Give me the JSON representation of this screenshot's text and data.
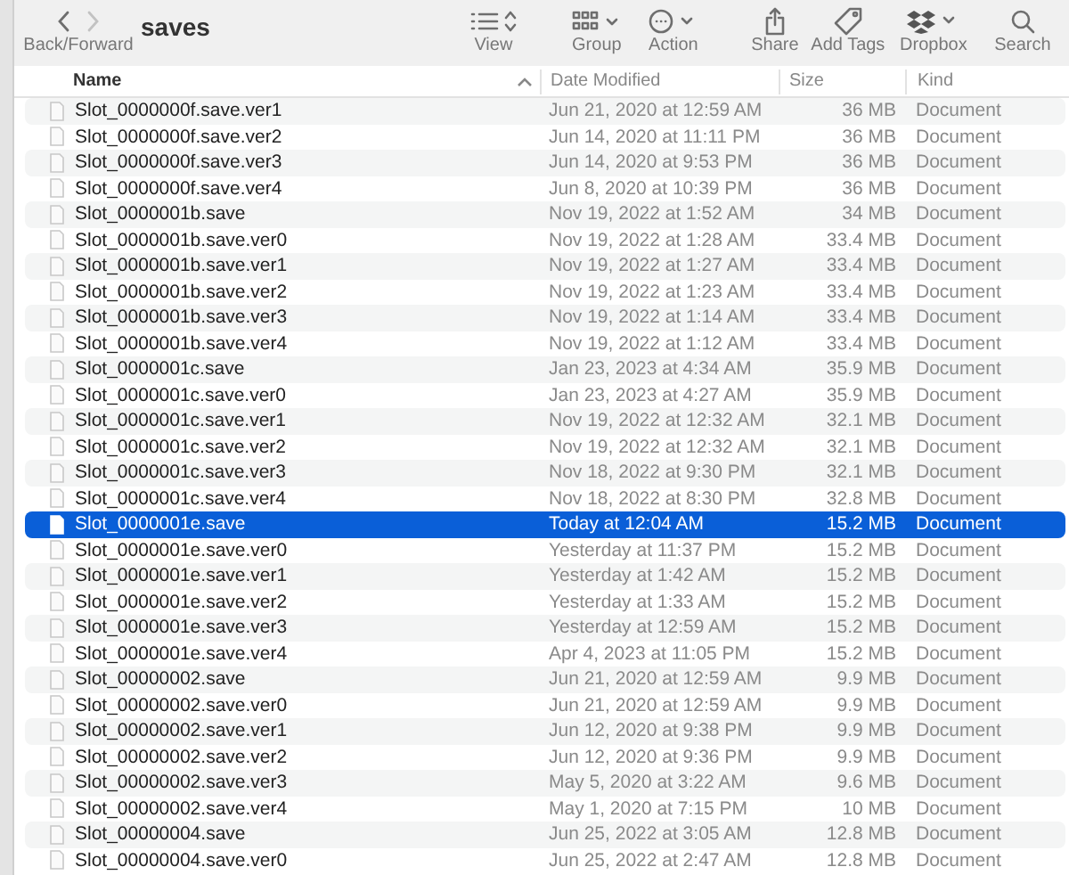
{
  "window": {
    "title": "saves"
  },
  "toolbar": {
    "back_forward_label": "Back/Forward",
    "back_enabled": true,
    "forward_enabled": false,
    "items": [
      {
        "kind": "view",
        "label": "View"
      },
      {
        "kind": "group",
        "label": "Group"
      },
      {
        "kind": "action",
        "label": "Action"
      },
      {
        "kind": "share",
        "label": "Share"
      },
      {
        "kind": "tags",
        "label": "Add Tags"
      },
      {
        "kind": "dropbox",
        "label": "Dropbox"
      },
      {
        "kind": "search",
        "label": "Search"
      }
    ]
  },
  "table": {
    "columns": [
      {
        "label": "Name",
        "sorted": true
      },
      {
        "label": "Date Modified",
        "sorted": false
      },
      {
        "label": "Size",
        "sorted": false
      },
      {
        "label": "Kind",
        "sorted": false
      }
    ],
    "rows": [
      {
        "name": "Slot_0000000f.save.ver1",
        "date": "Jun 21, 2020 at 12:59 AM",
        "size": "36 MB",
        "kind": "Document",
        "selected": false
      },
      {
        "name": "Slot_0000000f.save.ver2",
        "date": "Jun 14, 2020 at 11:11 PM",
        "size": "36 MB",
        "kind": "Document",
        "selected": false
      },
      {
        "name": "Slot_0000000f.save.ver3",
        "date": "Jun 14, 2020 at 9:53 PM",
        "size": "36 MB",
        "kind": "Document",
        "selected": false
      },
      {
        "name": "Slot_0000000f.save.ver4",
        "date": "Jun 8, 2020 at 10:39 PM",
        "size": "36 MB",
        "kind": "Document",
        "selected": false
      },
      {
        "name": "Slot_0000001b.save",
        "date": "Nov 19, 2022 at 1:52 AM",
        "size": "34 MB",
        "kind": "Document",
        "selected": false
      },
      {
        "name": "Slot_0000001b.save.ver0",
        "date": "Nov 19, 2022 at 1:28 AM",
        "size": "33.4 MB",
        "kind": "Document",
        "selected": false
      },
      {
        "name": "Slot_0000001b.save.ver1",
        "date": "Nov 19, 2022 at 1:27 AM",
        "size": "33.4 MB",
        "kind": "Document",
        "selected": false
      },
      {
        "name": "Slot_0000001b.save.ver2",
        "date": "Nov 19, 2022 at 1:23 AM",
        "size": "33.4 MB",
        "kind": "Document",
        "selected": false
      },
      {
        "name": "Slot_0000001b.save.ver3",
        "date": "Nov 19, 2022 at 1:14 AM",
        "size": "33.4 MB",
        "kind": "Document",
        "selected": false
      },
      {
        "name": "Slot_0000001b.save.ver4",
        "date": "Nov 19, 2022 at 1:12 AM",
        "size": "33.4 MB",
        "kind": "Document",
        "selected": false
      },
      {
        "name": "Slot_0000001c.save",
        "date": "Jan 23, 2023 at 4:34 AM",
        "size": "35.9 MB",
        "kind": "Document",
        "selected": false
      },
      {
        "name": "Slot_0000001c.save.ver0",
        "date": "Jan 23, 2023 at 4:27 AM",
        "size": "35.9 MB",
        "kind": "Document",
        "selected": false
      },
      {
        "name": "Slot_0000001c.save.ver1",
        "date": "Nov 19, 2022 at 12:32 AM",
        "size": "32.1 MB",
        "kind": "Document",
        "selected": false
      },
      {
        "name": "Slot_0000001c.save.ver2",
        "date": "Nov 19, 2022 at 12:32 AM",
        "size": "32.1 MB",
        "kind": "Document",
        "selected": false
      },
      {
        "name": "Slot_0000001c.save.ver3",
        "date": "Nov 18, 2022 at 9:30 PM",
        "size": "32.1 MB",
        "kind": "Document",
        "selected": false
      },
      {
        "name": "Slot_0000001c.save.ver4",
        "date": "Nov 18, 2022 at 8:30 PM",
        "size": "32.8 MB",
        "kind": "Document",
        "selected": false
      },
      {
        "name": "Slot_0000001e.save",
        "date": "Today at 12:04 AM",
        "size": "15.2 MB",
        "kind": "Document",
        "selected": true
      },
      {
        "name": "Slot_0000001e.save.ver0",
        "date": "Yesterday at 11:37 PM",
        "size": "15.2 MB",
        "kind": "Document",
        "selected": false
      },
      {
        "name": "Slot_0000001e.save.ver1",
        "date": "Yesterday at 1:42 AM",
        "size": "15.2 MB",
        "kind": "Document",
        "selected": false
      },
      {
        "name": "Slot_0000001e.save.ver2",
        "date": "Yesterday at 1:33 AM",
        "size": "15.2 MB",
        "kind": "Document",
        "selected": false
      },
      {
        "name": "Slot_0000001e.save.ver3",
        "date": "Yesterday at 12:59 AM",
        "size": "15.2 MB",
        "kind": "Document",
        "selected": false
      },
      {
        "name": "Slot_0000001e.save.ver4",
        "date": "Apr 4, 2023 at 11:05 PM",
        "size": "15.2 MB",
        "kind": "Document",
        "selected": false
      },
      {
        "name": "Slot_00000002.save",
        "date": "Jun 21, 2020 at 12:59 AM",
        "size": "9.9 MB",
        "kind": "Document",
        "selected": false
      },
      {
        "name": "Slot_00000002.save.ver0",
        "date": "Jun 21, 2020 at 12:59 AM",
        "size": "9.9 MB",
        "kind": "Document",
        "selected": false
      },
      {
        "name": "Slot_00000002.save.ver1",
        "date": "Jun 12, 2020 at 9:38 PM",
        "size": "9.9 MB",
        "kind": "Document",
        "selected": false
      },
      {
        "name": "Slot_00000002.save.ver2",
        "date": "Jun 12, 2020 at 9:36 PM",
        "size": "9.9 MB",
        "kind": "Document",
        "selected": false
      },
      {
        "name": "Slot_00000002.save.ver3",
        "date": "May 5, 2020 at 3:22 AM",
        "size": "9.6 MB",
        "kind": "Document",
        "selected": false
      },
      {
        "name": "Slot_00000002.save.ver4",
        "date": "May 1, 2020 at 7:15 PM",
        "size": "10 MB",
        "kind": "Document",
        "selected": false
      },
      {
        "name": "Slot_00000004.save",
        "date": "Jun 25, 2022 at 3:05 AM",
        "size": "12.8 MB",
        "kind": "Document",
        "selected": false
      },
      {
        "name": "Slot_00000004.save.ver0",
        "date": "Jun 25, 2022 at 2:47 AM",
        "size": "12.8 MB",
        "kind": "Document",
        "selected": false
      }
    ]
  }
}
